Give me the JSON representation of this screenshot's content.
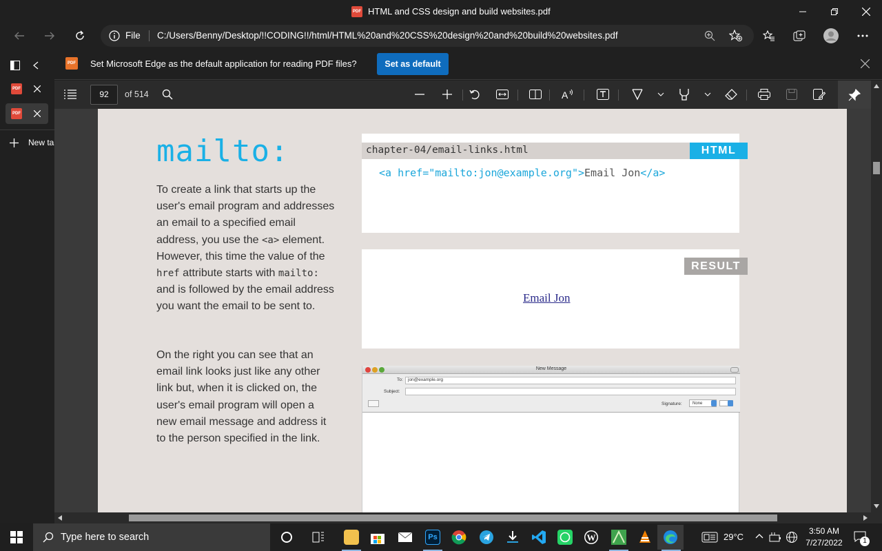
{
  "window": {
    "title": "HTML and CSS design and build websites.pdf",
    "title_badge": "PDF"
  },
  "address_bar": {
    "file_label": "File",
    "url": "C:/Users/Benny/Desktop/!!CODING!!/html/HTML%20and%20CSS%20design%20and%20build%20websites.pdf"
  },
  "vertical_tabs": {
    "tab_badge": "PDF",
    "new_tab_label": "New ta"
  },
  "infobar": {
    "badge": "PDF",
    "message": "Set Microsoft Edge as the default application for reading PDF files?",
    "button_label": "Set as default"
  },
  "pdf_toolbar": {
    "page_number": "92",
    "page_count_text": "of 514"
  },
  "pdf_page": {
    "heading": "mailto:",
    "paragraph1": {
      "before_a": "To create a link that starts up the user's email program and addresses an email to a specified email address, you use the ",
      "code_a": "<a>",
      "mid": " element. However, this time the value of the ",
      "code_href": "href",
      "mid2": " attribute starts with ",
      "code_mailto": "mailto:",
      "after": " and is followed by the email address you want the email to be sent to."
    },
    "paragraph2": "On the right you can see that an email link looks just like any other link but, when it is clicked on, the user's email program will open a new email message and address it to the person specified in the link.",
    "code_box": {
      "filename": "chapter-04/email-links.html",
      "label": "HTML",
      "code_open": "<a href=\"mailto:jon@example.org\">",
      "code_text": "Email Jon",
      "code_close": "</a>"
    },
    "result_box": {
      "label": "RESULT",
      "link_text": "Email Jon"
    },
    "mail_window": {
      "title": "New Message",
      "to_label": "To:",
      "to_value": "jon@example.org",
      "subject_label": "Subject:",
      "signature_label": "Signature:",
      "signature_value": "None"
    }
  },
  "taskbar": {
    "search_placeholder": "Type here to search",
    "temperature": "29°C",
    "time": "3:50 AM",
    "date": "7/27/2022",
    "notification_count": "1"
  },
  "colors": {
    "accent_blue": "#1ab0e6",
    "edge_button": "#0f6cbd",
    "page_bg": "#e4dfdc"
  }
}
